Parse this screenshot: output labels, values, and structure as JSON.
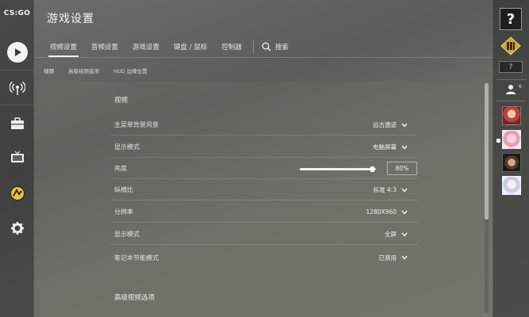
{
  "app": {
    "logo_text": "CS:GO"
  },
  "header": {
    "title": "游戏设置"
  },
  "tabs": [
    {
      "label": "视频设置",
      "active": true
    },
    {
      "label": "音频设置",
      "active": false
    },
    {
      "label": "游戏设置",
      "active": false
    },
    {
      "label": "键盘 / 鼠标",
      "active": false
    },
    {
      "label": "控制器",
      "active": false
    }
  ],
  "search": {
    "label": "搜索",
    "icon": "search-icon"
  },
  "subtabs": [
    {
      "label": "视频"
    },
    {
      "label": "高级视频选项"
    },
    {
      "label": "HUD 边缘位置"
    }
  ],
  "sections": {
    "video_title": "视频",
    "advanced_title": "高级视频选项"
  },
  "settings": {
    "menu_background": {
      "label": "主菜单背景风景",
      "value": "远古遗迹"
    },
    "display_mode": {
      "label": "显示模式",
      "value": "电脑屏幕"
    },
    "brightness": {
      "label": "亮度",
      "value": "80%",
      "fraction": 0.8
    },
    "aspect_ratio": {
      "label": "纵横比",
      "value": "标准 4:3"
    },
    "resolution": {
      "label": "分辨率",
      "value": "1280X960"
    },
    "display_mode_2": {
      "label": "显示模式",
      "value": "全屏"
    },
    "laptop_power": {
      "label": "笔记本节能模式",
      "value": "已禁用"
    }
  },
  "right_sidebar": {
    "help_label": "?",
    "small_help_label": "?",
    "friends_count": "6"
  },
  "colors": {
    "accent": "#f0f0f0",
    "panel": "#6e7068"
  }
}
